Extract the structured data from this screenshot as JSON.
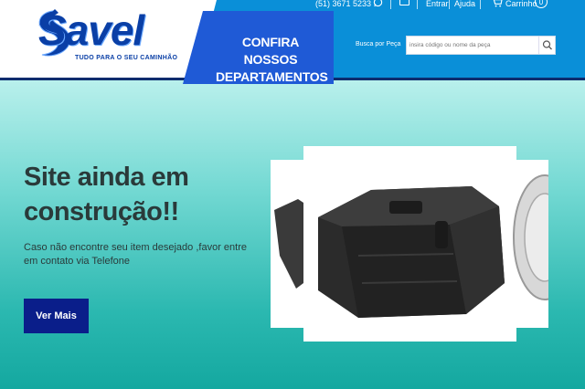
{
  "header": {
    "logo_text": "Savel",
    "logo_tagline": "TUDO PARA O SEU CAMINHÃO",
    "departments_button": "CONFIRA NOSSOS DEPARTAMENTOS",
    "phone": "(51) 3671 5233",
    "whatsapp_icon": "whatsapp-icon",
    "mail_icon": "mail-icon",
    "login": "Entrar",
    "help": "Ajuda",
    "cart_icon": "cart-icon",
    "cart_label": "Carrinho",
    "cart_count": "0",
    "search_label": "Busca por Peça",
    "search_placeholder": "insira código ou nome da peça",
    "search_icon": "search-icon"
  },
  "hero": {
    "title": "Site ainda em construção!!",
    "text": "Caso não encontre seu item desejado ,favor entre em contato via Telefone",
    "button": "Ver Mais"
  },
  "colors": {
    "header_blue": "#0a8fd8",
    "dept_blue": "#1f5ad6",
    "logo_blue": "#0a3fa6",
    "button_navy": "#0a1e8a",
    "hero_teal": "#2bb8b0"
  }
}
